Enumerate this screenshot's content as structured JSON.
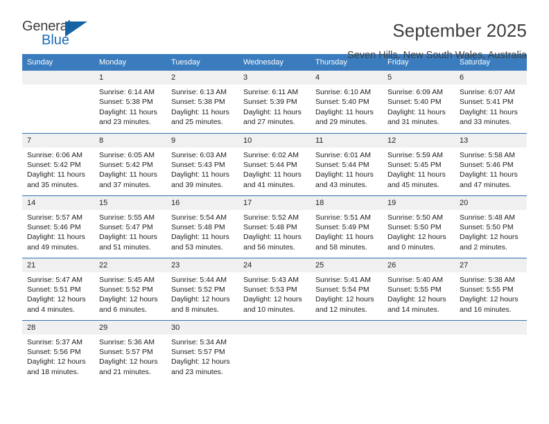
{
  "logo": {
    "word1": "General",
    "word2": "Blue",
    "triangle_color": "#1464a5",
    "word2_color": "#1a6bb5"
  },
  "header": {
    "title": "September 2025",
    "location": "Seven Hills, New South Wales, Australia"
  },
  "theme": {
    "header_row_bg": "#3a7cbe",
    "row_divider": "#2f6fad",
    "daynum_bg": "#f0f0f0",
    "text": "#1c1c1c"
  },
  "calendar": {
    "weekday_headers": [
      "Sunday",
      "Monday",
      "Tuesday",
      "Wednesday",
      "Thursday",
      "Friday",
      "Saturday"
    ],
    "weeks": [
      [
        {
          "day": "",
          "sunrise": "",
          "sunset": "",
          "daylight1": "",
          "daylight2": ""
        },
        {
          "day": "1",
          "sunrise": "Sunrise: 6:14 AM",
          "sunset": "Sunset: 5:38 PM",
          "daylight1": "Daylight: 11 hours",
          "daylight2": "and 23 minutes."
        },
        {
          "day": "2",
          "sunrise": "Sunrise: 6:13 AM",
          "sunset": "Sunset: 5:38 PM",
          "daylight1": "Daylight: 11 hours",
          "daylight2": "and 25 minutes."
        },
        {
          "day": "3",
          "sunrise": "Sunrise: 6:11 AM",
          "sunset": "Sunset: 5:39 PM",
          "daylight1": "Daylight: 11 hours",
          "daylight2": "and 27 minutes."
        },
        {
          "day": "4",
          "sunrise": "Sunrise: 6:10 AM",
          "sunset": "Sunset: 5:40 PM",
          "daylight1": "Daylight: 11 hours",
          "daylight2": "and 29 minutes."
        },
        {
          "day": "5",
          "sunrise": "Sunrise: 6:09 AM",
          "sunset": "Sunset: 5:40 PM",
          "daylight1": "Daylight: 11 hours",
          "daylight2": "and 31 minutes."
        },
        {
          "day": "6",
          "sunrise": "Sunrise: 6:07 AM",
          "sunset": "Sunset: 5:41 PM",
          "daylight1": "Daylight: 11 hours",
          "daylight2": "and 33 minutes."
        }
      ],
      [
        {
          "day": "7",
          "sunrise": "Sunrise: 6:06 AM",
          "sunset": "Sunset: 5:42 PM",
          "daylight1": "Daylight: 11 hours",
          "daylight2": "and 35 minutes."
        },
        {
          "day": "8",
          "sunrise": "Sunrise: 6:05 AM",
          "sunset": "Sunset: 5:42 PM",
          "daylight1": "Daylight: 11 hours",
          "daylight2": "and 37 minutes."
        },
        {
          "day": "9",
          "sunrise": "Sunrise: 6:03 AM",
          "sunset": "Sunset: 5:43 PM",
          "daylight1": "Daylight: 11 hours",
          "daylight2": "and 39 minutes."
        },
        {
          "day": "10",
          "sunrise": "Sunrise: 6:02 AM",
          "sunset": "Sunset: 5:44 PM",
          "daylight1": "Daylight: 11 hours",
          "daylight2": "and 41 minutes."
        },
        {
          "day": "11",
          "sunrise": "Sunrise: 6:01 AM",
          "sunset": "Sunset: 5:44 PM",
          "daylight1": "Daylight: 11 hours",
          "daylight2": "and 43 minutes."
        },
        {
          "day": "12",
          "sunrise": "Sunrise: 5:59 AM",
          "sunset": "Sunset: 5:45 PM",
          "daylight1": "Daylight: 11 hours",
          "daylight2": "and 45 minutes."
        },
        {
          "day": "13",
          "sunrise": "Sunrise: 5:58 AM",
          "sunset": "Sunset: 5:46 PM",
          "daylight1": "Daylight: 11 hours",
          "daylight2": "and 47 minutes."
        }
      ],
      [
        {
          "day": "14",
          "sunrise": "Sunrise: 5:57 AM",
          "sunset": "Sunset: 5:46 PM",
          "daylight1": "Daylight: 11 hours",
          "daylight2": "and 49 minutes."
        },
        {
          "day": "15",
          "sunrise": "Sunrise: 5:55 AM",
          "sunset": "Sunset: 5:47 PM",
          "daylight1": "Daylight: 11 hours",
          "daylight2": "and 51 minutes."
        },
        {
          "day": "16",
          "sunrise": "Sunrise: 5:54 AM",
          "sunset": "Sunset: 5:48 PM",
          "daylight1": "Daylight: 11 hours",
          "daylight2": "and 53 minutes."
        },
        {
          "day": "17",
          "sunrise": "Sunrise: 5:52 AM",
          "sunset": "Sunset: 5:48 PM",
          "daylight1": "Daylight: 11 hours",
          "daylight2": "and 56 minutes."
        },
        {
          "day": "18",
          "sunrise": "Sunrise: 5:51 AM",
          "sunset": "Sunset: 5:49 PM",
          "daylight1": "Daylight: 11 hours",
          "daylight2": "and 58 minutes."
        },
        {
          "day": "19",
          "sunrise": "Sunrise: 5:50 AM",
          "sunset": "Sunset: 5:50 PM",
          "daylight1": "Daylight: 12 hours",
          "daylight2": "and 0 minutes."
        },
        {
          "day": "20",
          "sunrise": "Sunrise: 5:48 AM",
          "sunset": "Sunset: 5:50 PM",
          "daylight1": "Daylight: 12 hours",
          "daylight2": "and 2 minutes."
        }
      ],
      [
        {
          "day": "21",
          "sunrise": "Sunrise: 5:47 AM",
          "sunset": "Sunset: 5:51 PM",
          "daylight1": "Daylight: 12 hours",
          "daylight2": "and 4 minutes."
        },
        {
          "day": "22",
          "sunrise": "Sunrise: 5:45 AM",
          "sunset": "Sunset: 5:52 PM",
          "daylight1": "Daylight: 12 hours",
          "daylight2": "and 6 minutes."
        },
        {
          "day": "23",
          "sunrise": "Sunrise: 5:44 AM",
          "sunset": "Sunset: 5:52 PM",
          "daylight1": "Daylight: 12 hours",
          "daylight2": "and 8 minutes."
        },
        {
          "day": "24",
          "sunrise": "Sunrise: 5:43 AM",
          "sunset": "Sunset: 5:53 PM",
          "daylight1": "Daylight: 12 hours",
          "daylight2": "and 10 minutes."
        },
        {
          "day": "25",
          "sunrise": "Sunrise: 5:41 AM",
          "sunset": "Sunset: 5:54 PM",
          "daylight1": "Daylight: 12 hours",
          "daylight2": "and 12 minutes."
        },
        {
          "day": "26",
          "sunrise": "Sunrise: 5:40 AM",
          "sunset": "Sunset: 5:55 PM",
          "daylight1": "Daylight: 12 hours",
          "daylight2": "and 14 minutes."
        },
        {
          "day": "27",
          "sunrise": "Sunrise: 5:38 AM",
          "sunset": "Sunset: 5:55 PM",
          "daylight1": "Daylight: 12 hours",
          "daylight2": "and 16 minutes."
        }
      ],
      [
        {
          "day": "28",
          "sunrise": "Sunrise: 5:37 AM",
          "sunset": "Sunset: 5:56 PM",
          "daylight1": "Daylight: 12 hours",
          "daylight2": "and 18 minutes."
        },
        {
          "day": "29",
          "sunrise": "Sunrise: 5:36 AM",
          "sunset": "Sunset: 5:57 PM",
          "daylight1": "Daylight: 12 hours",
          "daylight2": "and 21 minutes."
        },
        {
          "day": "30",
          "sunrise": "Sunrise: 5:34 AM",
          "sunset": "Sunset: 5:57 PM",
          "daylight1": "Daylight: 12 hours",
          "daylight2": "and 23 minutes."
        },
        {
          "day": "",
          "sunrise": "",
          "sunset": "",
          "daylight1": "",
          "daylight2": ""
        },
        {
          "day": "",
          "sunrise": "",
          "sunset": "",
          "daylight1": "",
          "daylight2": ""
        },
        {
          "day": "",
          "sunrise": "",
          "sunset": "",
          "daylight1": "",
          "daylight2": ""
        },
        {
          "day": "",
          "sunrise": "",
          "sunset": "",
          "daylight1": "",
          "daylight2": ""
        }
      ]
    ]
  }
}
